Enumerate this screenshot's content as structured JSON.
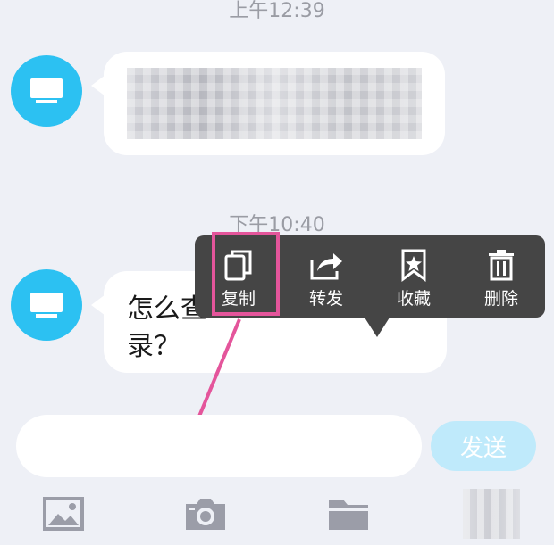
{
  "messages": [
    {
      "time": "上午12:39",
      "text": ""
    },
    {
      "time": "下午10:40",
      "text": "怎么查\n录？"
    }
  ],
  "context_menu": {
    "items": [
      {
        "label": "复制",
        "icon": "copy-icon"
      },
      {
        "label": "转发",
        "icon": "forward-icon"
      },
      {
        "label": "收藏",
        "icon": "bookmark-icon"
      },
      {
        "label": "删除",
        "icon": "trash-icon"
      }
    ],
    "highlight_color": "#e4559b"
  },
  "input": {
    "value": "",
    "placeholder": "",
    "send_label": "发送"
  },
  "toolbar": {
    "icons": [
      "image-icon",
      "camera-icon",
      "folder-icon"
    ]
  },
  "colors": {
    "avatar": "#2cc1f2",
    "send_button": "#bfeafb",
    "menu_bg": "#454545"
  }
}
